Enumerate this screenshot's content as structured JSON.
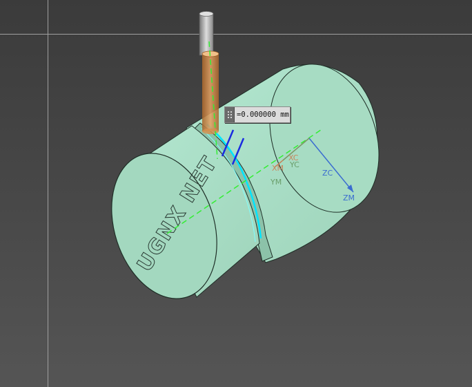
{
  "engraving": {
    "text": "UGNX NET"
  },
  "depth_input": {
    "value": "=0.000000",
    "unit": "mm"
  },
  "axes": {
    "xc": "XC",
    "yc": "YC",
    "zc": "ZC",
    "xm": "XM",
    "ym": "YM",
    "zm": "ZM"
  },
  "colors": {
    "background": "#444444",
    "part_face": "#a6dcc4",
    "part_edge": "#1e2e26",
    "tool_holder": "#cfcfcf",
    "tool": "#c7864a",
    "toolpath": "#00e5ff",
    "axis_line": "#33ee33",
    "xc_color": "#c8845a",
    "yc_color": "#6a9e6a",
    "zc_color": "#3a6cd0"
  }
}
